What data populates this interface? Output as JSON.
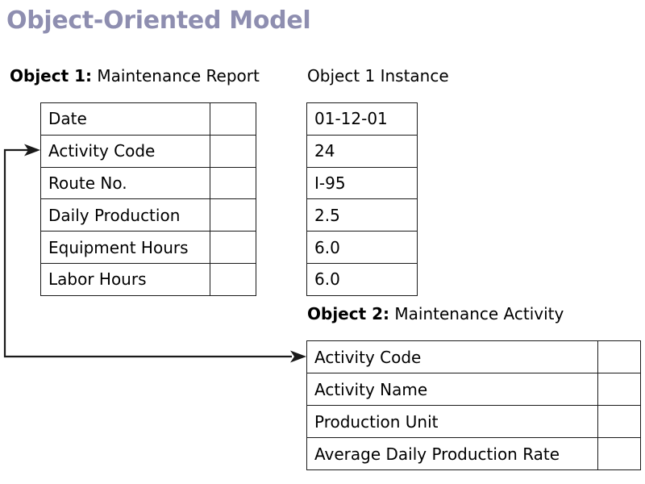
{
  "slide": {
    "title": "Object-Oriented Model",
    "title_color": "#8e8eb0",
    "background_color": "#ffffff",
    "line_color": "#1a1a1a"
  },
  "object1": {
    "heading_label": "Object 1:",
    "heading_name": "Maintenance Report",
    "attributes": [
      "Date",
      "Activity Code",
      "Route No.",
      "Daily Production",
      "Equipment Hours",
      "Labor Hours"
    ],
    "values": [
      "",
      "",
      "",
      "",
      "",
      ""
    ]
  },
  "instance1": {
    "heading": "Object 1 Instance",
    "values": [
      "01-12-01",
      "24",
      "I-95",
      "2.5",
      "6.0",
      "6.0"
    ]
  },
  "object2": {
    "heading_label": "Object 2:",
    "heading_name": "Maintenance Activity",
    "attributes": [
      "Activity Code",
      "Activity Name",
      "Production Unit",
      "Average Daily Production Rate"
    ],
    "values": [
      "",
      "",
      "",
      ""
    ]
  },
  "connector": {
    "name": "activity-code-relationship",
    "from_attribute": "Activity Code",
    "to_attribute": "Activity Code",
    "arrowheads": 2
  }
}
